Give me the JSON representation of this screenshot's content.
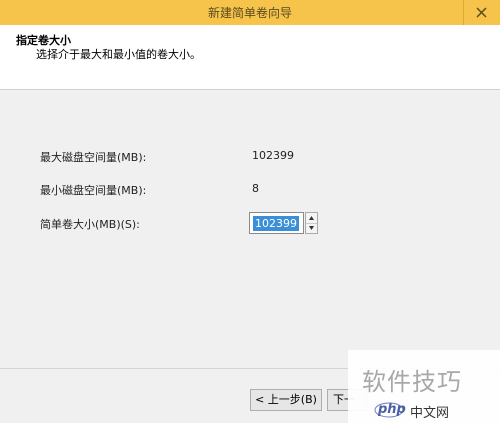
{
  "window": {
    "title": "新建简单卷向导"
  },
  "header": {
    "title": "指定卷大小",
    "subtitle": "选择介于最大和最小值的卷大小。"
  },
  "fields": {
    "max_label": "最大磁盘空间量(MB):",
    "max_value": "102399",
    "min_label": "最小磁盘空间量(MB):",
    "min_value": "8",
    "size_label": "简单卷大小(MB)(S):",
    "size_value": "102399"
  },
  "buttons": {
    "back_label": "< 上一步(B)",
    "next_label": "下一"
  },
  "watermark": {
    "text": "软件技巧",
    "brand_php": "php",
    "brand_cn": "中文网"
  },
  "colors": {
    "titlebar": "#f7c44b",
    "selection": "#3a8fd8"
  }
}
